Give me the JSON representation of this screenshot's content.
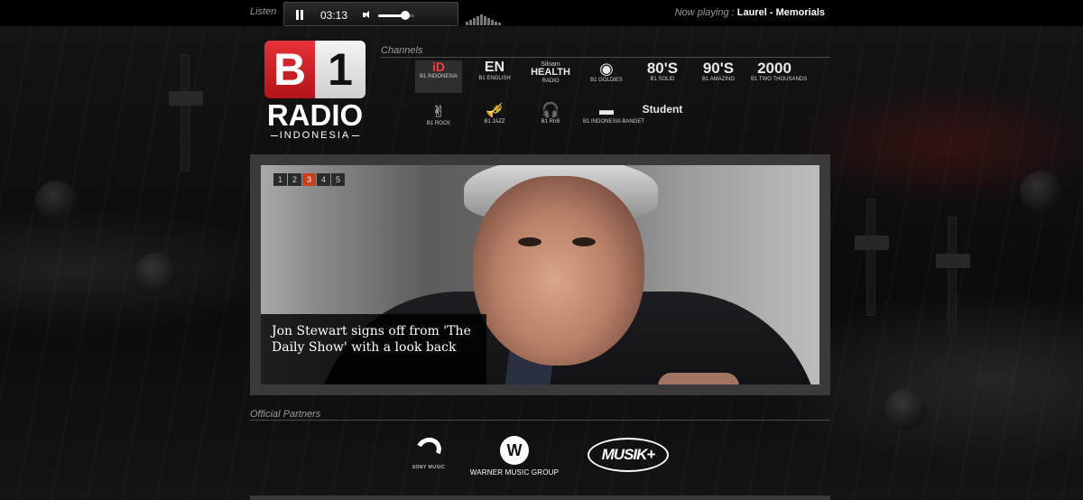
{
  "player": {
    "listen_label": "Listen",
    "time": "03:13",
    "volume": 0.75,
    "now_playing_label": "Now playing :",
    "now_playing_track": "Laurel - Memorials"
  },
  "logo": {
    "b": "B",
    "one": "1",
    "radio": "RADIO",
    "indonesia": "INDONESIA"
  },
  "channels": {
    "label": "Channels",
    "items": [
      {
        "logo": "iD",
        "caption": "B1 INDONESIA",
        "active": true
      },
      {
        "logo": "EN",
        "caption": "B1 ENGLISH"
      },
      {
        "logo": "HEALTH",
        "caption": "RADIO",
        "prefix": "Siloam"
      },
      {
        "logo": "◉",
        "caption": "B1 GOLDIES"
      },
      {
        "logo": "80'S",
        "caption": "B1 SOLID"
      },
      {
        "logo": "90'S",
        "caption": "B1 AMAZING"
      },
      {
        "logo": "2000",
        "caption": "B1 TWO THOUSANDS"
      },
      {
        "logo": "✌",
        "caption": "B1 ROCK"
      },
      {
        "logo": "🎺",
        "caption": "B1 JAZZ"
      },
      {
        "logo": "🎧",
        "caption": "B1 RnB"
      },
      {
        "logo": "▬",
        "caption": "B1 INDONESIA BANGET"
      },
      {
        "logo": "Student",
        "caption": ""
      }
    ]
  },
  "slider": {
    "pages": [
      "1",
      "2",
      "3",
      "4",
      "5"
    ],
    "active_page": 3,
    "caption": "Jon Stewart signs off from 'The Daily Show' with a look back"
  },
  "partners": {
    "label": "Official Partners",
    "sony_text": "SONY MUSIC",
    "wmg_text": "WARNER MUSIC GROUP",
    "musika_text": "MUSIK+"
  },
  "colors": {
    "accent": "#c8401e",
    "brand_red": "#e53238",
    "frame": "#3b3939"
  }
}
